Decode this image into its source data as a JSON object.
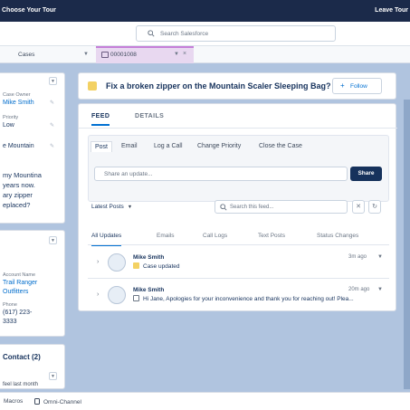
{
  "topbar": {
    "left_text": "Choose Your Tour",
    "right_text": "Leave Tour"
  },
  "search": {
    "placeholder": "Search Salesforce"
  },
  "tabs": {
    "cases_label": "Cases",
    "case_tab_label": "00001008"
  },
  "left_details": {
    "case_owner_label": "Case Owner",
    "case_owner_value": "Mike Smith",
    "priority_label": "Priority",
    "priority_value": "Low",
    "subject_fragment": "e Mountain",
    "description_lines": [
      "my Mountina",
      "years now.",
      "ary zipper",
      "eplaced?"
    ]
  },
  "account_card": {
    "account_name_label": "Account Name",
    "account_name_value_1": "Trail Ranger",
    "account_name_value_2": "Outfitters",
    "phone_label": "Phone",
    "phone_value_1": "(617) 223-",
    "phone_value_2": "3333"
  },
  "contact_card": {
    "title": "Contact (2)",
    "item": "feel last month"
  },
  "case_header": {
    "title": "Fix a broken zipper on the Mountain Scaler Sleeping Bag?",
    "follow_label": "Follow",
    "case_icon_color": "#f3d163"
  },
  "main_tabs": [
    "FEED",
    "DETAILS"
  ],
  "publisher": {
    "tabs": [
      "Post",
      "Email",
      "Log a Call",
      "Change Priority",
      "Close the Case"
    ],
    "share_placeholder": "Share an update...",
    "share_button": "Share"
  },
  "feed_controls": {
    "sort_label": "Latest Posts",
    "search_placeholder": "Search this feed...",
    "filter_tabs": [
      "All Updates",
      "Emails",
      "Call Logs",
      "Text Posts",
      "Status Changes"
    ]
  },
  "posts": [
    {
      "author": "Mike Smith",
      "message": "Case updated",
      "time": "3m ago",
      "icon": "case-icon"
    },
    {
      "author": "Mike Smith",
      "message": "Hi Jane, Apologies for your inconvenience and thank you for reaching out! Plea...",
      "time": "20m ago",
      "icon": "email-icon"
    }
  ],
  "utility_bar": {
    "macros": "Macros",
    "omni_channel": "Omni-Channel"
  },
  "colors": {
    "accent": "#0070d2",
    "header_bar": "#1b2a4a",
    "share_button": "#16325c",
    "background": "#b0c4df",
    "active_tab": "#e8d8f0"
  }
}
